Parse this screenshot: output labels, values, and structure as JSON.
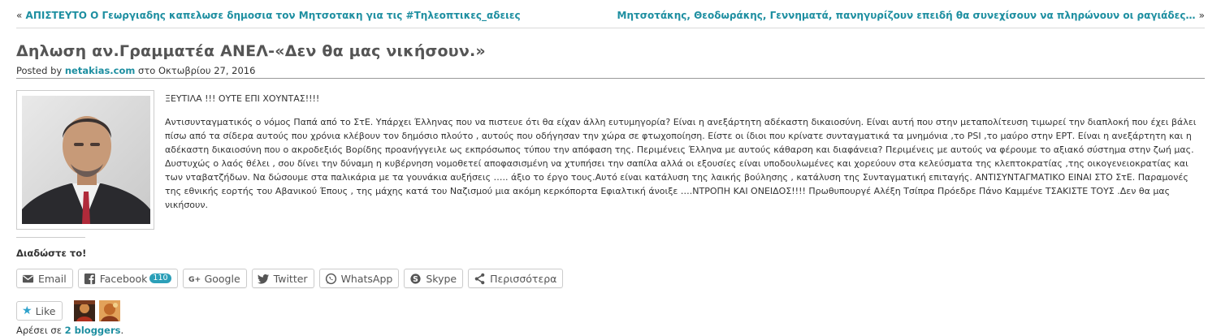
{
  "nav": {
    "prev_arrow": "«",
    "prev_label": "ΑΠΙΣΤΕΥΤΟ Ο Γεωργιαδης καπελωσε δημοσια τον Μητσοτακη για τις #Τηλεοπτικες_αδειες",
    "next_label": "Μητσοτάκης, Θεοδωράκης, Γεννηματά, πανηγυρίζουν επειδή θα συνεχίσουν να πληρώνουν οι ραγιάδες…",
    "next_arrow": "»"
  },
  "post": {
    "title": "Δηλωση αν.Γραμματέα ΑΝΕΛ-«Δεν θα μας νικήσουν.»",
    "posted_by": "Posted by",
    "author": "netakias.com",
    "date_prefix": "στο",
    "date": "Οκτωβρίου 27, 2016",
    "lead": "ΞΕΥΤΙΛΑ !!! ΟΥΤΕ ΕΠΙ ΧΟΥΝΤΑΣ!!!!",
    "body": "Αντισυνταγματικός ο νόμος Παπά από το ΣτΕ. Υπάρχει Έλληνας που να πιστευε ότι θα είχαν άλλη ευτυμηγορία? Είναι η ανεξάρτητη αδέκαστη δικαιοσύνη. Είναι αυτή που στην μεταπολίτευση τιμωρεί την διαπλοκή που έχει βάλει πίσω από τα σίδερα αυτούς που χρόνια κλέβουν τον δημόσιο πλούτο , αυτούς που οδήγησαν την χώρα σε φτωχοποίηση. Είστε οι ίδιοι που κρίνατε συνταγματικά τα μνημόνια ,το PSI ,το μαύρο στην ΕΡΤ. Είναι η ανεξάρτητη και η αδέκαστη δικαιοσύνη που ο ακροδεξιός Βορίδης προανήγγειλε ως εκπρόσωπος τύπου την απόφαση της. Περιμένεις Έλληνα με αυτούς κάθαρση και διαφάνεια? Περιμένεις με αυτούς να φέρουμε το αξιακό σύστημα στην ζωή μας. Δυστυχώς ο λαός θέλει , σου δίνει την δύναμη η κυβέρνηση νομοθετεί αποφασισμένη να χτυπήσει την σαπίλα αλλά οι εξουσίες είναι υποδουλωμένες και χορεύουν στα κελεύσματα της κλεπτοκρατίας ,της οικογενειοκρατίας και των νταβατζήδων. Να δώσουμε στα παλικάρια με τα γουνάκια αυξήσεις ….. άξιο το έργο τους.Αυτό είναι κατάλυση της λαικής βούλησης , κατάλυση της Συνταγματική επιταγής. ΑΝΤΙΣΥΝΤΑΓΜΑΤΙΚΟ ΕΙΝΑΙ ΣΤΟ ΣτΕ. Παραμονές της εθνικής εορτής του Αβανικού Έπους , της μάχης κατά του Ναζισμού μια ακόμη κερκόπορτα Εφιαλτική άνοιξε ….ΝΤΡΟΠΗ ΚΑΙ ΟΝΕΙΔΟΣ!!!! Πρωθυπουργέ Αλέξη Τσίπρα Πρόεδρε Πάνο Καμμένε ΤΣΑΚΙΣΤΕ ΤΟΥΣ .Δεν θα μας νικήσουν."
  },
  "share": {
    "title": "Διαδώστε το!",
    "buttons": [
      {
        "label": "Email",
        "icon": "email-icon"
      },
      {
        "label": "Facebook",
        "icon": "facebook-icon",
        "count": "110"
      },
      {
        "label": "Google",
        "icon": "google-plus-icon"
      },
      {
        "label": "Twitter",
        "icon": "twitter-icon"
      },
      {
        "label": "WhatsApp",
        "icon": "whatsapp-icon"
      },
      {
        "label": "Skype",
        "icon": "skype-icon"
      },
      {
        "label": "Περισσότερα",
        "icon": "share-icon"
      }
    ]
  },
  "likes": {
    "button_label": "Like",
    "text_prefix": "Αρέσει σε",
    "bloggers": "2 bloggers",
    "text_suffix": "."
  },
  "colors": {
    "link": "#1e8fa1",
    "badge": "#2b9fb8"
  }
}
